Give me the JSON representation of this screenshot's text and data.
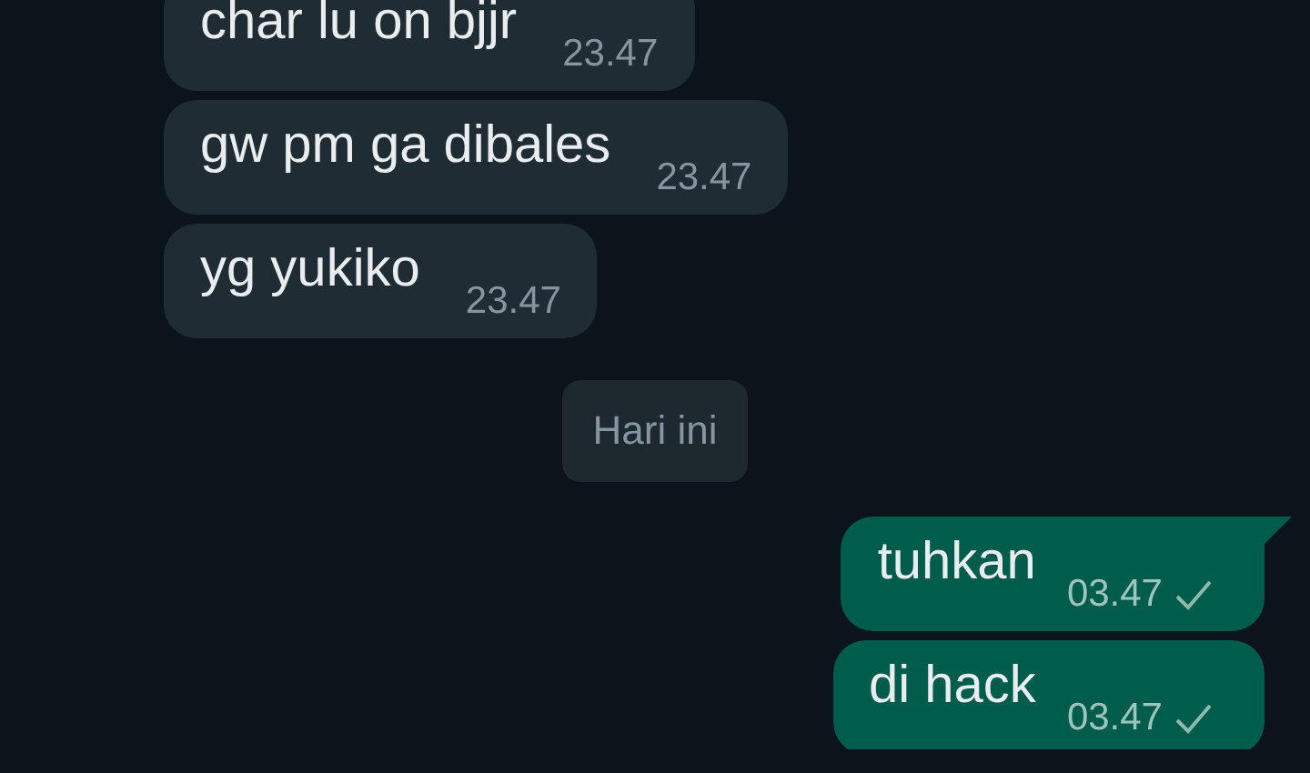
{
  "messages": [
    {
      "kind": "incoming",
      "text": "char lu on bjjr",
      "time": "23.47"
    },
    {
      "kind": "incoming",
      "text": "gw pm ga dibales",
      "time": "23.47"
    },
    {
      "kind": "incoming",
      "text": "yg yukiko",
      "time": "23.47"
    },
    {
      "kind": "date",
      "text": "Hari ini"
    },
    {
      "kind": "outgoing",
      "text": "tuhkan",
      "time": "03.47",
      "sent": true,
      "tail": true
    },
    {
      "kind": "outgoing",
      "text": "di hack",
      "time": "03.47",
      "sent": true,
      "tail": false
    }
  ]
}
